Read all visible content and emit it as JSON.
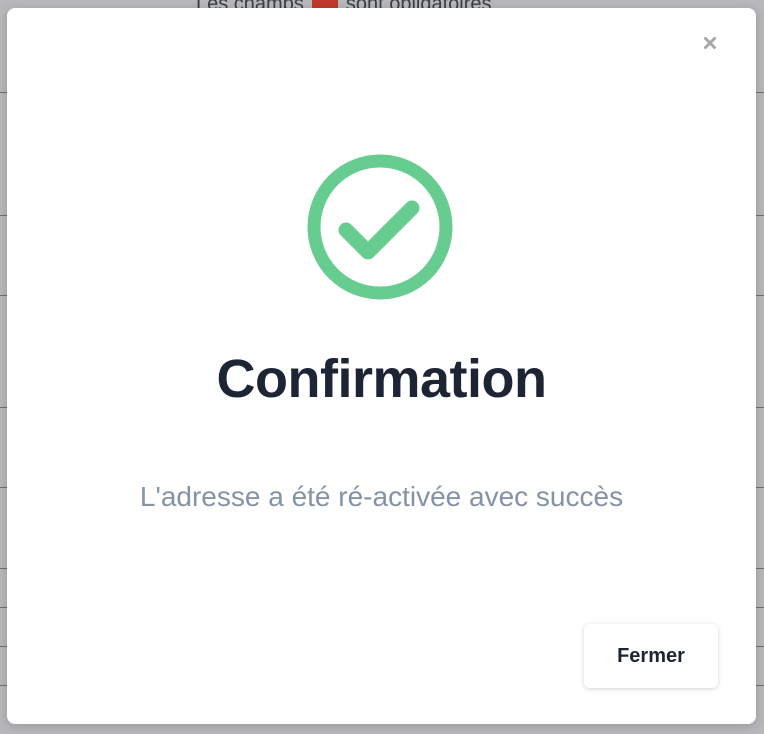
{
  "background": {
    "hint_text_start": "Les champs",
    "hint_text_end": "sont obligatoires"
  },
  "modal": {
    "close_icon": "close-icon",
    "status_icon": "check-circle-icon",
    "accent_color": "#66cc8f",
    "title": "Confirmation",
    "message": "L'adresse a été ré-activée avec succès",
    "footer_button_label": "Fermer"
  }
}
